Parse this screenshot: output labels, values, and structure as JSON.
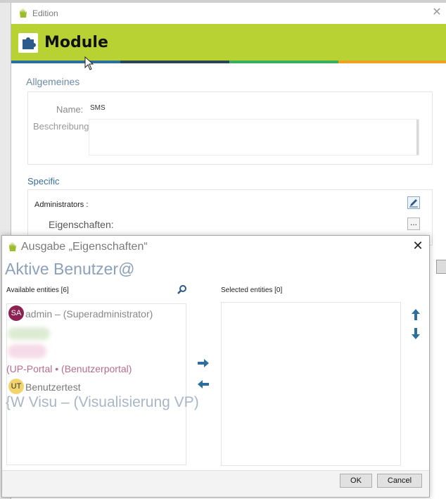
{
  "edition_window": {
    "title": "Edition",
    "close_glyph": "✕",
    "module_header": "Module",
    "stripe_colors": [
      "#2c6e9e",
      "#2a4456",
      "#3aae5c",
      "#f0a020"
    ],
    "accent_color": "#b8d233",
    "section_general": "Allgemeines",
    "name_label": "Name:",
    "name_value": "SMS",
    "description_label": "Beschreibung:",
    "section_specific": "Specific",
    "administrators_label": "Administrators :",
    "properties_label": "Eigenschaften:",
    "properties_button": "..."
  },
  "ausgabe_dialog": {
    "title": "Ausgabe „Eigenschaften“",
    "close_glyph": "✕",
    "overlay_title": "Aktive Benutzer@",
    "available_label": "Available entities [6]",
    "selected_label": "Selected entities [0]",
    "available_items": [
      {
        "initials": "SA",
        "label": "admin – (Superadministrator)",
        "avatar_color": "#8b2252"
      },
      {
        "initials": "",
        "label": "(UP-Portal • (Benutzerportal)",
        "avatar_color": ""
      },
      {
        "initials": "UT",
        "label": "Benutzertest",
        "avatar_color": "#f3d36b"
      },
      {
        "initials": "",
        "label": "{W Visu – (Visualisierung VP)",
        "avatar_color": ""
      }
    ],
    "ok_label": "OK",
    "cancel_label": "Cancel",
    "icons": [
      "search-icon",
      "arrow-right-icon",
      "arrow-left-icon",
      "arrow-up-icon",
      "arrow-down-icon",
      "hand-icon",
      "puzzle-icon",
      "pencil-icon"
    ]
  }
}
